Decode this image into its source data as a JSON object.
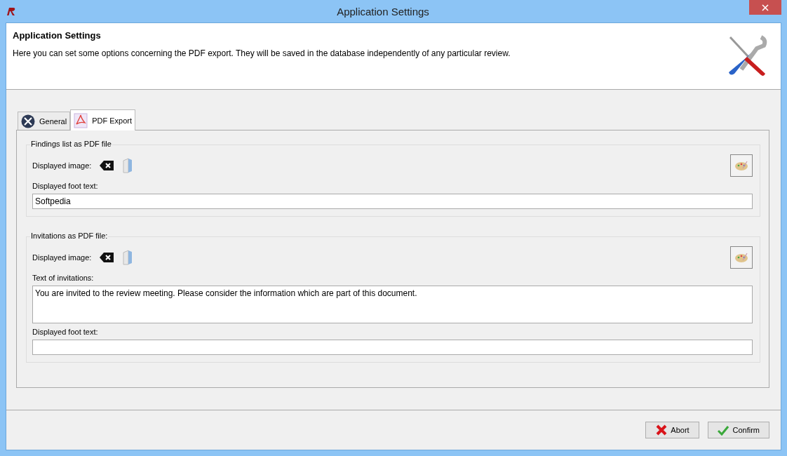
{
  "window": {
    "title": "Application Settings"
  },
  "header": {
    "title": "Application Settings",
    "description": "Here you can set some options concerning the PDF export. They will be saved in the database independently of any particular review."
  },
  "tabs": [
    {
      "label": "General",
      "kind": "tools",
      "selected": false
    },
    {
      "label": "PDF Export",
      "kind": "pdf",
      "selected": true
    }
  ],
  "sections": [
    {
      "title": "Findings list as PDF file",
      "image_label": "Displayed image:",
      "fields": [
        {
          "kind": "line",
          "label": "Displayed foot text:",
          "value": "Softpedia"
        }
      ]
    },
    {
      "title": "Invitations as PDF file:",
      "image_label": "Displayed image:",
      "fields": [
        {
          "kind": "area",
          "label": "Text of invitations:",
          "value": "You are invited to the review meeting. Please consider the information which are part of this document."
        },
        {
          "kind": "line",
          "label": "Displayed foot text:"
        }
      ]
    }
  ],
  "buttons": [
    {
      "label": "Abort",
      "kind": "abort"
    },
    {
      "label": "Confirm",
      "kind": "confirm"
    }
  ]
}
